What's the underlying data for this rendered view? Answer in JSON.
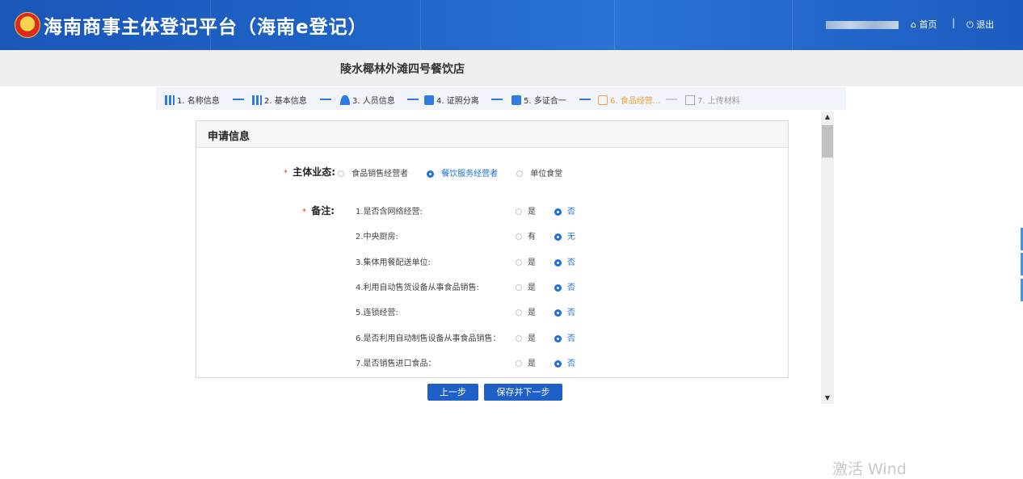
{
  "header": {
    "title": "海南商事主体登记平台（海南e登记）",
    "home_label": "首页",
    "separator": "|",
    "exit_label": "退出"
  },
  "company": {
    "name": "陵水椰林外滩四号餐饮店"
  },
  "steps": [
    {
      "label": "1. 名称信息",
      "icon": "bar-chart-icon",
      "state": "done"
    },
    {
      "label": "2. 基本信息",
      "icon": "bar-chart-icon",
      "state": "done"
    },
    {
      "label": "3. 人员信息",
      "icon": "person-icon",
      "state": "done"
    },
    {
      "label": "4. 证照分离",
      "icon": "card-icon",
      "state": "done"
    },
    {
      "label": "5. 多证合一",
      "icon": "id-card-icon",
      "state": "done"
    },
    {
      "label": "6. 食品经营...",
      "icon": "food-icon",
      "state": "active"
    },
    {
      "label": "7. 上传材料",
      "icon": "upload-icon",
      "state": "future"
    }
  ],
  "panel": {
    "title": "申请信息",
    "business_type": {
      "required_mark": "*",
      "label": "主体业态:",
      "options": [
        "食品销售经营者",
        "餐饮服务经营者",
        "单位食堂"
      ],
      "selected": "餐饮服务经营者"
    },
    "remarks": {
      "required_mark": "*",
      "label": "备注:",
      "items": [
        {
          "question": "1.是否含网络经营:",
          "opt_a": "是",
          "opt_b": "否",
          "selected": "否"
        },
        {
          "question": "2.中央厨房:",
          "opt_a": "有",
          "opt_b": "无",
          "selected": "无"
        },
        {
          "question": "3.集体用餐配送单位:",
          "opt_a": "是",
          "opt_b": "否",
          "selected": "否"
        },
        {
          "question": "4.利用自动售货设备从事食品销售:",
          "opt_a": "是",
          "opt_b": "否",
          "selected": "否"
        },
        {
          "question": "5.连锁经营:",
          "opt_a": "是",
          "opt_b": "否",
          "selected": "否"
        },
        {
          "question": "6.是否利用自动制售设备从事食品销售：",
          "opt_a": "是",
          "opt_b": "否",
          "selected": "否"
        },
        {
          "question": "7.是否销售进口食品：",
          "opt_a": "是",
          "opt_b": "否",
          "selected": "否"
        }
      ]
    }
  },
  "buttons": {
    "prev": "上一步",
    "save_next": "保存并下一步"
  },
  "colors": {
    "header_blue": "#1f63c6",
    "accent_blue": "#1e6fde",
    "active_orange": "#f0a23b",
    "required_red": "#e53935"
  },
  "watermark": "激活 Wind"
}
